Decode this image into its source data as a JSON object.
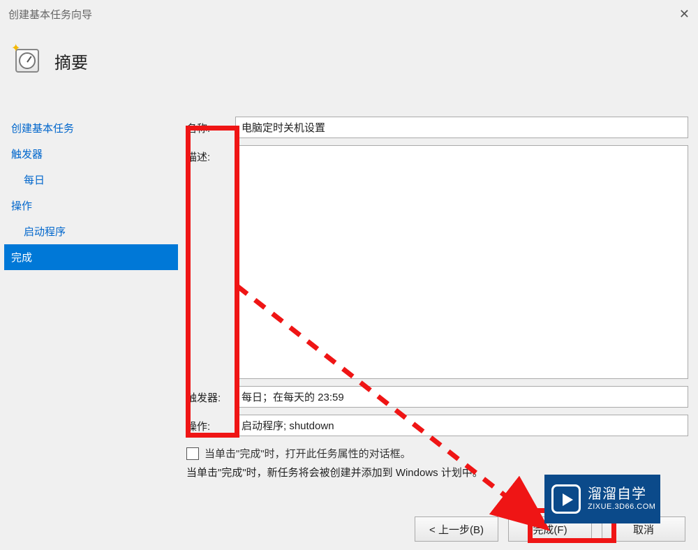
{
  "window": {
    "title": "创建基本任务向导",
    "close_label": "✕"
  },
  "header": {
    "title": "摘要"
  },
  "sidebar": {
    "items": [
      {
        "label": "创建基本任务",
        "sub": false,
        "selected": false
      },
      {
        "label": "触发器",
        "sub": false,
        "selected": false
      },
      {
        "label": "每日",
        "sub": true,
        "selected": false
      },
      {
        "label": "操作",
        "sub": false,
        "selected": false
      },
      {
        "label": "启动程序",
        "sub": true,
        "selected": false
      },
      {
        "label": "完成",
        "sub": false,
        "selected": true
      }
    ]
  },
  "form": {
    "name_label": "名称:",
    "name_value": "电脑定时关机设置",
    "desc_label": "描述:",
    "desc_value": "",
    "trigger_label": "触发器:",
    "trigger_value": "每日；在每天的 23:59",
    "action_label": "操作:",
    "action_value": "启动程序; shutdown",
    "checkbox_label": "当单击\"完成\"时，打开此任务属性的对话框。",
    "note": "当单击\"完成\"时，新任务将会被创建并添加到 Windows 计划中。"
  },
  "buttons": {
    "back": "< 上一步(B)",
    "finish": "完成(F)",
    "cancel": "取消"
  },
  "watermark": {
    "title": "溜溜自学",
    "sub": "ZIXUE.3D66.COM"
  }
}
